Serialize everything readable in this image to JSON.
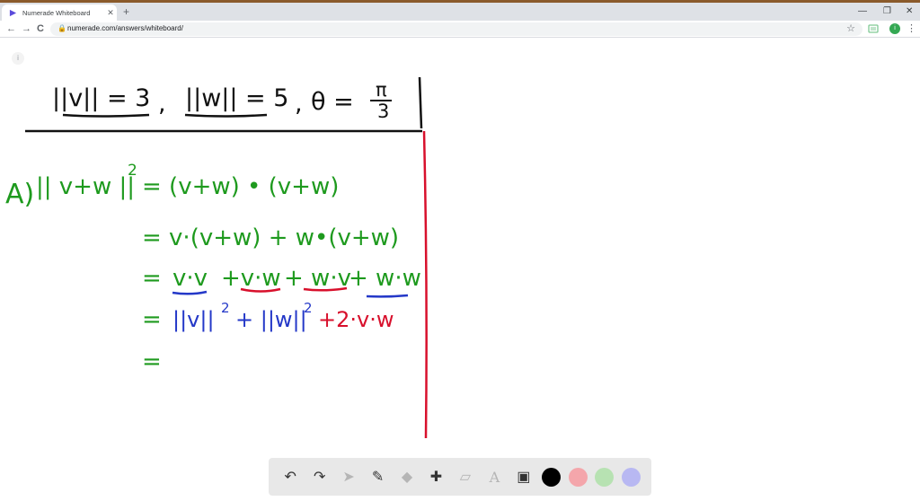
{
  "browser": {
    "tab_title": "Numerade Whiteboard",
    "tab_close": "✕",
    "new_tab": "+",
    "minimize": "—",
    "restore": "❐",
    "close": "✕",
    "back": "←",
    "forward": "→",
    "reload": "C",
    "lock": "🔒",
    "url": "numerade.com/answers/whiteboard/",
    "star": "☆",
    "profile_initial": "i",
    "menu": "⋮"
  },
  "whiteboard": {
    "info_label": "i",
    "given": {
      "v_norm": "||v|| = 3",
      "sep1": ",",
      "w_norm": "||w|| = 5",
      "sep2": ",",
      "theta_lhs": "θ =",
      "theta_num": "π",
      "theta_den": "3"
    },
    "lines": {
      "l1_part": "A)",
      "l1_lhs": "|| v+w ||",
      "l1_exp": "2",
      "l1_rhs": "= (v+w) • (v+w)",
      "l2": "= v·(v+w) + w•(v+w)",
      "l3_eq": "=",
      "l3_t1": "v·v",
      "l3_t2": "+v·w",
      "l3_t3": "+ w·v",
      "l3_t4": "+ w·w",
      "l4_eq": "=",
      "l4_t1": "||v||",
      "l4_e1": "2",
      "l4_t2": "+ ||w||",
      "l4_e2": "2",
      "l4_t3": "+2·v·w",
      "l5_eq": "="
    },
    "ink_colors": {
      "black": "#111111",
      "green": "#1e9a1e",
      "blue": "#2438c8",
      "red": "#d8102c"
    }
  },
  "palette": {
    "undo": "↶",
    "redo": "↷",
    "select": "➤",
    "pen": "✎",
    "shapes": "◆",
    "add": "✚",
    "eraser": "▱",
    "text": "A",
    "image": "▣",
    "colors": [
      "#000000",
      "#f4a6ab",
      "#b7e2b2",
      "#b8b8f2"
    ]
  }
}
